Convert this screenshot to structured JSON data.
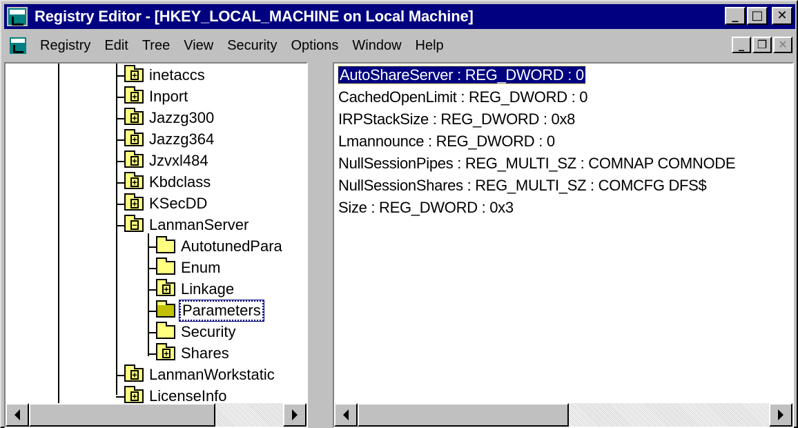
{
  "window": {
    "title": "Registry Editor - [HKEY_LOCAL_MACHINE on Local Machine]",
    "title_buttons": {
      "minimize": "_",
      "maximize": "□",
      "close": "✕"
    }
  },
  "menu": {
    "items": [
      "Registry",
      "Edit",
      "Tree",
      "View",
      "Security",
      "Options",
      "Window",
      "Help"
    ],
    "mdi_buttons": {
      "minimize": "_",
      "restore": "❐",
      "close": "✕"
    }
  },
  "tree": {
    "items": [
      {
        "label": "inetaccs",
        "state": "collapsed"
      },
      {
        "label": "Inport",
        "state": "collapsed"
      },
      {
        "label": "Jazzg300",
        "state": "collapsed"
      },
      {
        "label": "Jazzg364",
        "state": "collapsed"
      },
      {
        "label": "Jzvxl484",
        "state": "collapsed"
      },
      {
        "label": "Kbdclass",
        "state": "collapsed"
      },
      {
        "label": "KSecDD",
        "state": "collapsed"
      },
      {
        "label": "LanmanServer",
        "state": "expanded"
      },
      {
        "label": "AutotunedPara",
        "state": "leaf"
      },
      {
        "label": "Enum",
        "state": "leaf"
      },
      {
        "label": "Linkage",
        "state": "collapsed"
      },
      {
        "label": "Parameters",
        "state": "selected"
      },
      {
        "label": "Security",
        "state": "leaf"
      },
      {
        "label": "Shares",
        "state": "collapsed"
      },
      {
        "label": "LanmanWorkstatic",
        "state": "collapsed"
      },
      {
        "label": "LicenseInfo",
        "state": "collapsed"
      }
    ]
  },
  "values": [
    "AutoShareServer : REG_DWORD : 0",
    "CachedOpenLimit : REG_DWORD : 0",
    "IRPStackSize : REG_DWORD : 0x8",
    "Lmannounce : REG_DWORD : 0",
    "NullSessionPipes : REG_MULTI_SZ : COMNAP COMNODE",
    "NullSessionShares : REG_MULTI_SZ : COMCFG DFS$",
    "Size : REG_DWORD : 0x3"
  ],
  "colors": {
    "title_bg": "#000080",
    "face": "#c0c0c0",
    "selection": "#000080",
    "folder": "#ffff80"
  }
}
